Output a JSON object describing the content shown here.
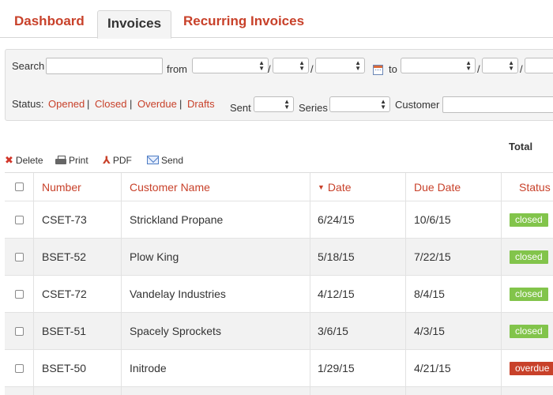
{
  "tabs": [
    {
      "label": "Dashboard"
    },
    {
      "label": "Invoices"
    },
    {
      "label": "Recurring Invoices"
    }
  ],
  "filters": {
    "search_label": "Search",
    "from_label": "from",
    "to_label": "to",
    "date_separator": "/",
    "status_label": "Status:",
    "status_links": [
      "Opened",
      "Closed",
      "Overdue",
      "Drafts"
    ],
    "status_separator": "|",
    "sent_label": "Sent",
    "series_label": "Series",
    "customer_label": "Customer"
  },
  "toolbar": {
    "delete": "Delete",
    "print": "Print",
    "pdf": "PDF",
    "send": "Send",
    "total": "Total"
  },
  "table": {
    "headers": {
      "number": "Number",
      "customer": "Customer Name",
      "date": "Date",
      "due": "Due Date",
      "status": "Status"
    },
    "rows": [
      {
        "number": "CSET-73",
        "customer": "Strickland Propane",
        "date": "6/24/15",
        "due": "10/6/15",
        "status": "closed"
      },
      {
        "number": "BSET-52",
        "customer": "Plow King",
        "date": "5/18/15",
        "due": "7/22/15",
        "status": "closed"
      },
      {
        "number": "CSET-72",
        "customer": "Vandelay Industries",
        "date": "4/12/15",
        "due": "8/4/15",
        "status": "closed"
      },
      {
        "number": "BSET-51",
        "customer": "Spacely Sprockets",
        "date": "3/6/15",
        "due": "4/3/15",
        "status": "closed"
      },
      {
        "number": "BSET-50",
        "customer": "Initrode",
        "date": "1/29/15",
        "due": "4/21/15",
        "status": "overdue"
      }
    ]
  },
  "colors": {
    "accent": "#c8412a",
    "closed_badge": "#82c44b",
    "overdue_badge": "#c8412a"
  }
}
